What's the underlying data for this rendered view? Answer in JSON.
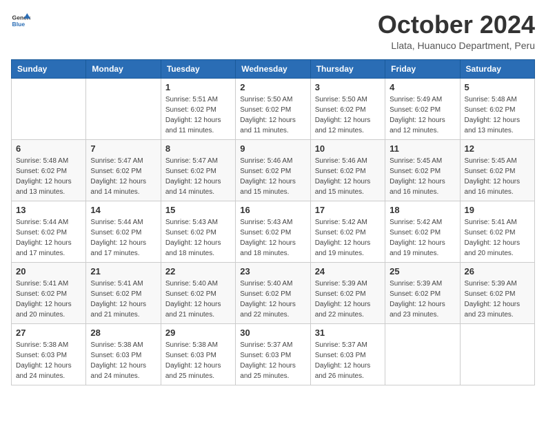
{
  "logo": {
    "general": "General",
    "blue": "Blue"
  },
  "title": "October 2024",
  "location": "Llata, Huanuco Department, Peru",
  "headers": [
    "Sunday",
    "Monday",
    "Tuesday",
    "Wednesday",
    "Thursday",
    "Friday",
    "Saturday"
  ],
  "weeks": [
    [
      {
        "day": "",
        "info": ""
      },
      {
        "day": "",
        "info": ""
      },
      {
        "day": "1",
        "sunrise": "Sunrise: 5:51 AM",
        "sunset": "Sunset: 6:02 PM",
        "daylight": "Daylight: 12 hours and 11 minutes."
      },
      {
        "day": "2",
        "sunrise": "Sunrise: 5:50 AM",
        "sunset": "Sunset: 6:02 PM",
        "daylight": "Daylight: 12 hours and 11 minutes."
      },
      {
        "day": "3",
        "sunrise": "Sunrise: 5:50 AM",
        "sunset": "Sunset: 6:02 PM",
        "daylight": "Daylight: 12 hours and 12 minutes."
      },
      {
        "day": "4",
        "sunrise": "Sunrise: 5:49 AM",
        "sunset": "Sunset: 6:02 PM",
        "daylight": "Daylight: 12 hours and 12 minutes."
      },
      {
        "day": "5",
        "sunrise": "Sunrise: 5:48 AM",
        "sunset": "Sunset: 6:02 PM",
        "daylight": "Daylight: 12 hours and 13 minutes."
      }
    ],
    [
      {
        "day": "6",
        "sunrise": "Sunrise: 5:48 AM",
        "sunset": "Sunset: 6:02 PM",
        "daylight": "Daylight: 12 hours and 13 minutes."
      },
      {
        "day": "7",
        "sunrise": "Sunrise: 5:47 AM",
        "sunset": "Sunset: 6:02 PM",
        "daylight": "Daylight: 12 hours and 14 minutes."
      },
      {
        "day": "8",
        "sunrise": "Sunrise: 5:47 AM",
        "sunset": "Sunset: 6:02 PM",
        "daylight": "Daylight: 12 hours and 14 minutes."
      },
      {
        "day": "9",
        "sunrise": "Sunrise: 5:46 AM",
        "sunset": "Sunset: 6:02 PM",
        "daylight": "Daylight: 12 hours and 15 minutes."
      },
      {
        "day": "10",
        "sunrise": "Sunrise: 5:46 AM",
        "sunset": "Sunset: 6:02 PM",
        "daylight": "Daylight: 12 hours and 15 minutes."
      },
      {
        "day": "11",
        "sunrise": "Sunrise: 5:45 AM",
        "sunset": "Sunset: 6:02 PM",
        "daylight": "Daylight: 12 hours and 16 minutes."
      },
      {
        "day": "12",
        "sunrise": "Sunrise: 5:45 AM",
        "sunset": "Sunset: 6:02 PM",
        "daylight": "Daylight: 12 hours and 16 minutes."
      }
    ],
    [
      {
        "day": "13",
        "sunrise": "Sunrise: 5:44 AM",
        "sunset": "Sunset: 6:02 PM",
        "daylight": "Daylight: 12 hours and 17 minutes."
      },
      {
        "day": "14",
        "sunrise": "Sunrise: 5:44 AM",
        "sunset": "Sunset: 6:02 PM",
        "daylight": "Daylight: 12 hours and 17 minutes."
      },
      {
        "day": "15",
        "sunrise": "Sunrise: 5:43 AM",
        "sunset": "Sunset: 6:02 PM",
        "daylight": "Daylight: 12 hours and 18 minutes."
      },
      {
        "day": "16",
        "sunrise": "Sunrise: 5:43 AM",
        "sunset": "Sunset: 6:02 PM",
        "daylight": "Daylight: 12 hours and 18 minutes."
      },
      {
        "day": "17",
        "sunrise": "Sunrise: 5:42 AM",
        "sunset": "Sunset: 6:02 PM",
        "daylight": "Daylight: 12 hours and 19 minutes."
      },
      {
        "day": "18",
        "sunrise": "Sunrise: 5:42 AM",
        "sunset": "Sunset: 6:02 PM",
        "daylight": "Daylight: 12 hours and 19 minutes."
      },
      {
        "day": "19",
        "sunrise": "Sunrise: 5:41 AM",
        "sunset": "Sunset: 6:02 PM",
        "daylight": "Daylight: 12 hours and 20 minutes."
      }
    ],
    [
      {
        "day": "20",
        "sunrise": "Sunrise: 5:41 AM",
        "sunset": "Sunset: 6:02 PM",
        "daylight": "Daylight: 12 hours and 20 minutes."
      },
      {
        "day": "21",
        "sunrise": "Sunrise: 5:41 AM",
        "sunset": "Sunset: 6:02 PM",
        "daylight": "Daylight: 12 hours and 21 minutes."
      },
      {
        "day": "22",
        "sunrise": "Sunrise: 5:40 AM",
        "sunset": "Sunset: 6:02 PM",
        "daylight": "Daylight: 12 hours and 21 minutes."
      },
      {
        "day": "23",
        "sunrise": "Sunrise: 5:40 AM",
        "sunset": "Sunset: 6:02 PM",
        "daylight": "Daylight: 12 hours and 22 minutes."
      },
      {
        "day": "24",
        "sunrise": "Sunrise: 5:39 AM",
        "sunset": "Sunset: 6:02 PM",
        "daylight": "Daylight: 12 hours and 22 minutes."
      },
      {
        "day": "25",
        "sunrise": "Sunrise: 5:39 AM",
        "sunset": "Sunset: 6:02 PM",
        "daylight": "Daylight: 12 hours and 23 minutes."
      },
      {
        "day": "26",
        "sunrise": "Sunrise: 5:39 AM",
        "sunset": "Sunset: 6:02 PM",
        "daylight": "Daylight: 12 hours and 23 minutes."
      }
    ],
    [
      {
        "day": "27",
        "sunrise": "Sunrise: 5:38 AM",
        "sunset": "Sunset: 6:03 PM",
        "daylight": "Daylight: 12 hours and 24 minutes."
      },
      {
        "day": "28",
        "sunrise": "Sunrise: 5:38 AM",
        "sunset": "Sunset: 6:03 PM",
        "daylight": "Daylight: 12 hours and 24 minutes."
      },
      {
        "day": "29",
        "sunrise": "Sunrise: 5:38 AM",
        "sunset": "Sunset: 6:03 PM",
        "daylight": "Daylight: 12 hours and 25 minutes."
      },
      {
        "day": "30",
        "sunrise": "Sunrise: 5:37 AM",
        "sunset": "Sunset: 6:03 PM",
        "daylight": "Daylight: 12 hours and 25 minutes."
      },
      {
        "day": "31",
        "sunrise": "Sunrise: 5:37 AM",
        "sunset": "Sunset: 6:03 PM",
        "daylight": "Daylight: 12 hours and 26 minutes."
      },
      {
        "day": "",
        "info": ""
      },
      {
        "day": "",
        "info": ""
      }
    ]
  ]
}
